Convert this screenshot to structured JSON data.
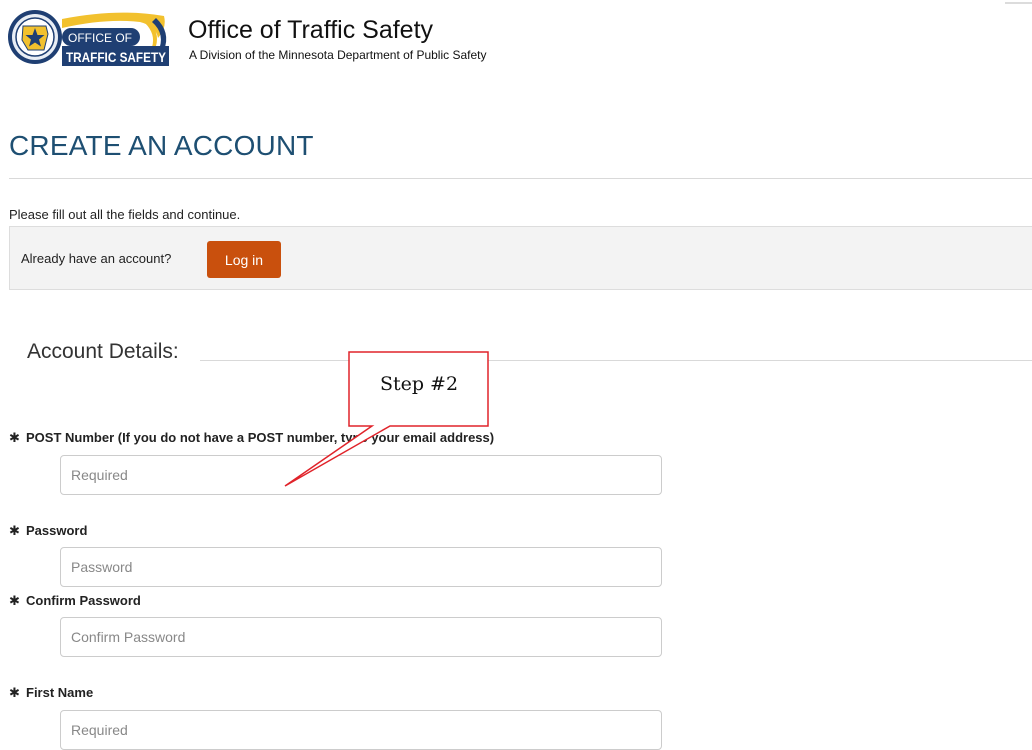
{
  "header": {
    "logo": {
      "line1": "OFFICE OF",
      "line2": "TRAFFIC SAFETY"
    },
    "title": "Office of Traffic Safety",
    "subtitle": "A Division of the Minnesota Department of Public Safety"
  },
  "page": {
    "title": "CREATE AN ACCOUNT",
    "instructions": "Please fill out all the fields and continue."
  },
  "login": {
    "prompt": "Already have an account?",
    "button_label": "Log in"
  },
  "section": {
    "title": "Account Details:"
  },
  "form": {
    "required_marker": "✱",
    "fields": [
      {
        "label": "POST Number (If you do not have a POST number, type your email address)",
        "placeholder": "Required",
        "value": ""
      },
      {
        "label": "Password",
        "placeholder": "Password",
        "value": ""
      },
      {
        "label": "Confirm Password",
        "placeholder": "Confirm Password",
        "value": ""
      },
      {
        "label": "First Name",
        "placeholder": "Required",
        "value": ""
      }
    ]
  },
  "annotation": {
    "text": "Step #2"
  },
  "colors": {
    "title_blue": "#1e4f72",
    "login_button": "#c9500d",
    "callout_border": "#e0232a",
    "logo_navy": "#1f3f73",
    "logo_gold": "#f2c12e"
  }
}
